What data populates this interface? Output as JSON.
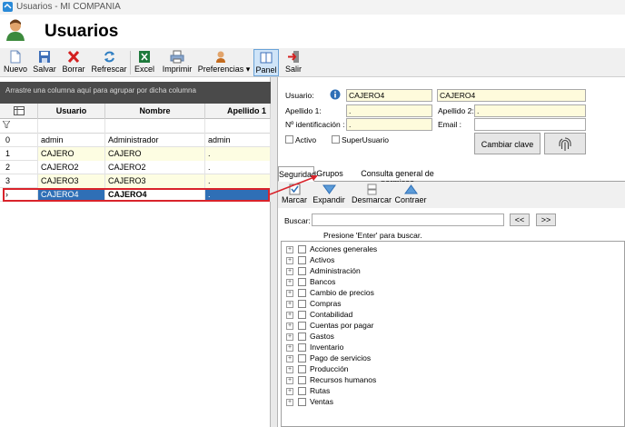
{
  "window": {
    "title": "Usuarios - MI COMPANIA"
  },
  "page": {
    "title": "Usuarios"
  },
  "toolbar": {
    "new": "Nuevo",
    "save": "Salvar",
    "delete": "Borrar",
    "refresh": "Refrescar",
    "excel": "Excel",
    "print": "Imprimir",
    "prefs": "Preferencias",
    "panel": "Panel",
    "exit": "Salir"
  },
  "grid": {
    "group_hint": "Arrastre una columna aquí para agrupar por dicha columna",
    "columns": [
      "Usuario",
      "Nombre",
      "Apellido 1"
    ],
    "filter_icon": "filter-icon",
    "rows": [
      {
        "num": "0",
        "usuario": "admin",
        "nombre": "Administrador",
        "apellido": "admin"
      },
      {
        "num": "1",
        "usuario": "CAJERO",
        "nombre": "CAJERO",
        "apellido": "."
      },
      {
        "num": "2",
        "usuario": "CAJERO2",
        "nombre": "CAJERO2",
        "apellido": "."
      },
      {
        "num": "3",
        "usuario": "CAJERO3",
        "nombre": "CAJERO3",
        "apellido": "."
      },
      {
        "num": "",
        "usuario": "CAJERO4",
        "nombre": "CAJERO4",
        "apellido": "."
      }
    ]
  },
  "form": {
    "usuario_label": "Usuario:",
    "usuario_value": "CAJERO4",
    "nombre_value": "CAJERO4",
    "apellido1_label": "Apellido 1:",
    "apellido1_value": ".",
    "apellido2_label": "Apellido 2:",
    "apellido2_value": ".",
    "id_label": "Nº identificación :",
    "id_value": ".",
    "email_label": "Email :",
    "email_value": "",
    "activo_label": "Activo",
    "super_label": "SuperUsuario",
    "change_pw": "Cambiar clave"
  },
  "tabs": [
    "Seguridad",
    "Grupos",
    "Consulta general de permisos"
  ],
  "perm_toolbar": {
    "mark": "Marcar",
    "expand": "Expandir",
    "unmark": "Desmarcar",
    "collapse": "Contraer"
  },
  "search": {
    "label": "Buscar:",
    "value": "",
    "prev": "<<",
    "next": ">>",
    "hint": "Presione 'Enter' para buscar."
  },
  "tree": [
    "Acciones generales",
    "Activos",
    "Administración",
    "Bancos",
    "Cambio de precios",
    "Compras",
    "Contabilidad",
    "Cuentas por pagar",
    "Gastos",
    "Inventario",
    "Pago de servicios",
    "Producción",
    "Recursos humanos",
    "Rutas",
    "Ventas"
  ],
  "colors": {
    "accent": "#2f6fb6",
    "highlight": "#d9232b",
    "field_yellow": "#fefbdc"
  }
}
